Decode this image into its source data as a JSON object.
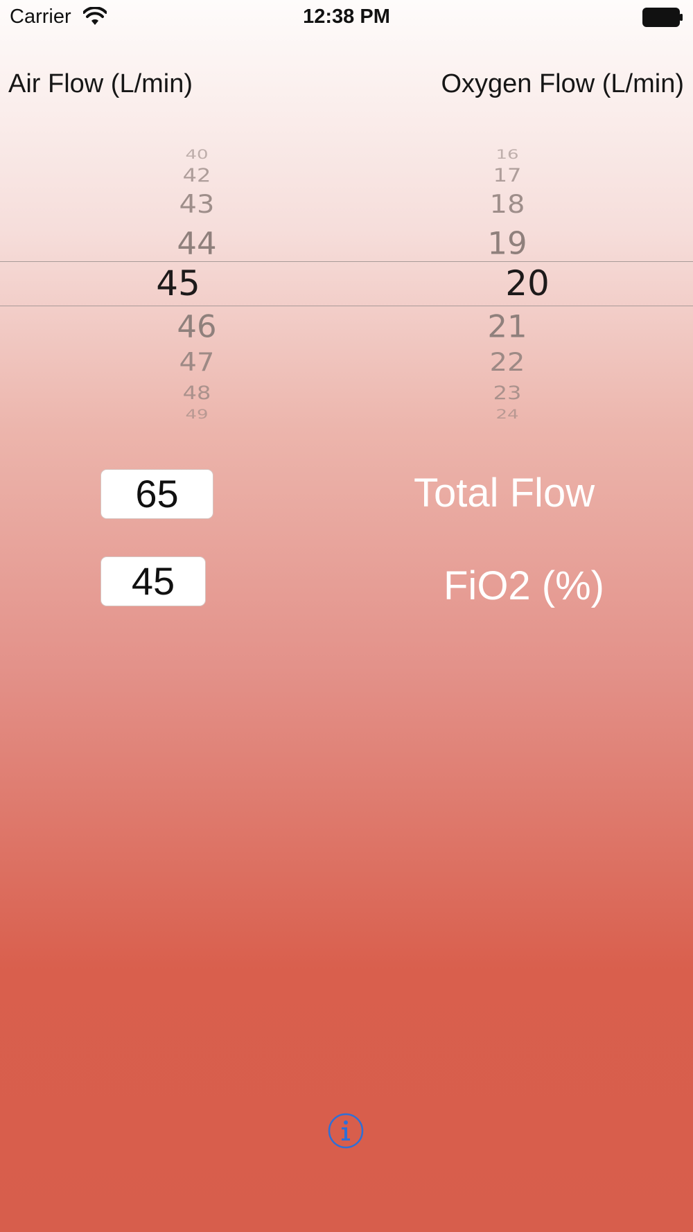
{
  "status_bar": {
    "carrier": "Carrier",
    "time": "12:38 PM"
  },
  "headers": {
    "air_flow": "Air Flow (L/min)",
    "oxygen_flow": "Oxygen Flow (L/min)"
  },
  "air_picker": {
    "selected": "45",
    "items_above": [
      "40",
      "42",
      "43",
      "44"
    ],
    "items_below": [
      "46",
      "47",
      "48",
      "49"
    ]
  },
  "oxygen_picker": {
    "selected": "20",
    "items_above": [
      "16",
      "17",
      "18",
      "19"
    ],
    "items_below": [
      "21",
      "22",
      "23",
      "24"
    ]
  },
  "results": {
    "total_flow_value": "65",
    "total_flow_label": "Total Flow",
    "fio2_value": "45",
    "fio2_label": "FiO2 (%)"
  },
  "icons": {
    "wifi": "wifi-icon",
    "battery": "battery-icon",
    "info": "info-icon"
  },
  "colors": {
    "accent": "#2f6fd6",
    "gradient_top": "#fefcfb",
    "gradient_bottom": "#d75e4c"
  }
}
